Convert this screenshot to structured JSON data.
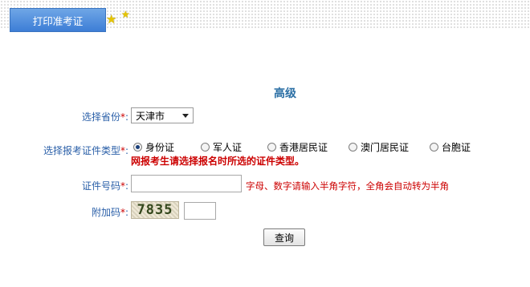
{
  "tab": {
    "label": "打印准考证"
  },
  "title": "高级",
  "form": {
    "province": {
      "label": "选择省份",
      "required": "*",
      "colon": ":",
      "value": "天津市"
    },
    "id_type": {
      "label": "选择报考证件类型",
      "required": "*",
      "colon": ":",
      "options": [
        "身份证",
        "军人证",
        "香港居民证",
        "澳门居民证",
        "台胞证"
      ],
      "selected": "身份证",
      "warning": "网报考生请选择报名时所选的证件类型。"
    },
    "id_number": {
      "label": "证件号码",
      "required": "*",
      "colon": ":",
      "value": "",
      "hint": "字母、数字请输入半角字符，全角会自动转为半角"
    },
    "captcha": {
      "label": "附加码",
      "required": "*",
      "colon": ":",
      "image_text": "7835",
      "value": ""
    },
    "submit_label": "查询"
  },
  "colors": {
    "tab_blue": "#3d7ed6",
    "title_blue": "#2b6fa5",
    "label_blue": "#2a5fa8",
    "warning_red": "#cc0000"
  }
}
